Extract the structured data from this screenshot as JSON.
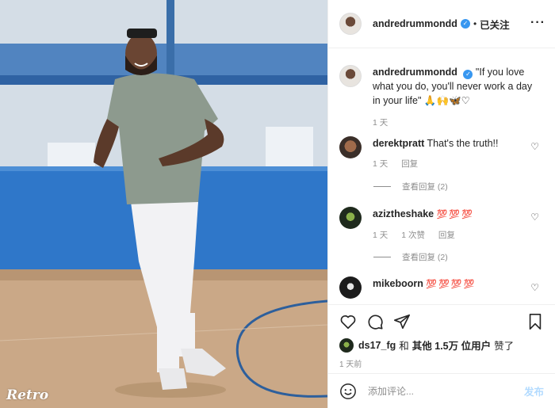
{
  "photo": {
    "watermark": "Retro"
  },
  "post": {
    "username": "andredrummondd",
    "verified_mark": "✓",
    "separator": "•",
    "follow_label": "已关注",
    "more_label": "···",
    "caption": "\"If you love what you do, you'll never work a day in your life\" 🙏🙌🦋♡",
    "caption_time": "1 天"
  },
  "comments": [
    {
      "username": "derektpratt",
      "text": "That's the truth!!",
      "time": "1 天",
      "likes": "",
      "reply_label": "回复",
      "view_replies": "查看回复 (2)"
    },
    {
      "username": "aziztheshake",
      "text": "💯💯💯",
      "time": "1 天",
      "likes": "1 次赞",
      "reply_label": "回复",
      "view_replies": "查看回复 (2)"
    },
    {
      "username": "mikeboorn",
      "text": "💯💯💯💯",
      "time": "",
      "likes": "",
      "reply_label": "",
      "view_replies": ""
    }
  ],
  "likes_line": {
    "user": "ds17_fg",
    "and": "和",
    "others": "其他 1.5万 位用户",
    "liked": "赞了"
  },
  "post_time": "1 天前",
  "add_comment": {
    "placeholder": "添加评论...",
    "post_label": "发布"
  },
  "icons": [
    "heart-icon",
    "comment-icon",
    "share-icon",
    "bookmark-icon",
    "smile-icon",
    "verified-icon",
    "more-icon"
  ],
  "colors": {
    "verified": "#3897f0",
    "post_button": "#b3dbff",
    "meta_text": "#8e8e8e"
  }
}
